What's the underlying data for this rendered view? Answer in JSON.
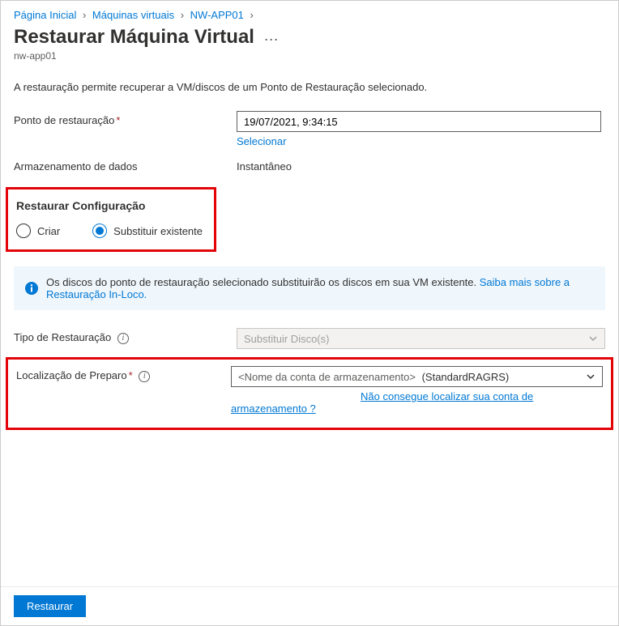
{
  "breadcrumb": {
    "home": "Página Inicial",
    "vms": "Máquinas virtuais",
    "vm": "NW-APP01"
  },
  "header": {
    "title": "Restaurar Máquina Virtual",
    "subtitle": "nw-app01"
  },
  "description": "A restauração permite recuperar a VM/discos de um Ponto de Restauração selecionado.",
  "fields": {
    "restore_point_label": "Ponto de restauração",
    "restore_point_value": "19/07/2021, 9:34:15",
    "select_link": "Selecionar",
    "data_storage_label": "Armazenamento de dados",
    "data_storage_value": "Instantâneo"
  },
  "config": {
    "section_title": "Restaurar Configuração",
    "create_label": "Criar",
    "replace_label": "Substituir existente"
  },
  "banner": {
    "text": "Os discos do ponto de restauração selecionado substituirão os discos em sua VM existente. ",
    "link": "Saiba mais sobre a Restauração In-Loco."
  },
  "restore_type": {
    "label": "Tipo de Restauração",
    "value": "Substituir Disco(s)"
  },
  "staging": {
    "label": "Localização de Preparo",
    "placeholder": "<Nome da conta de armazenamento>",
    "extra": "(StandardRAGRS)",
    "help_link": "Não consegue localizar sua conta de armazenamento ?"
  },
  "footer": {
    "button": "Restaurar"
  }
}
